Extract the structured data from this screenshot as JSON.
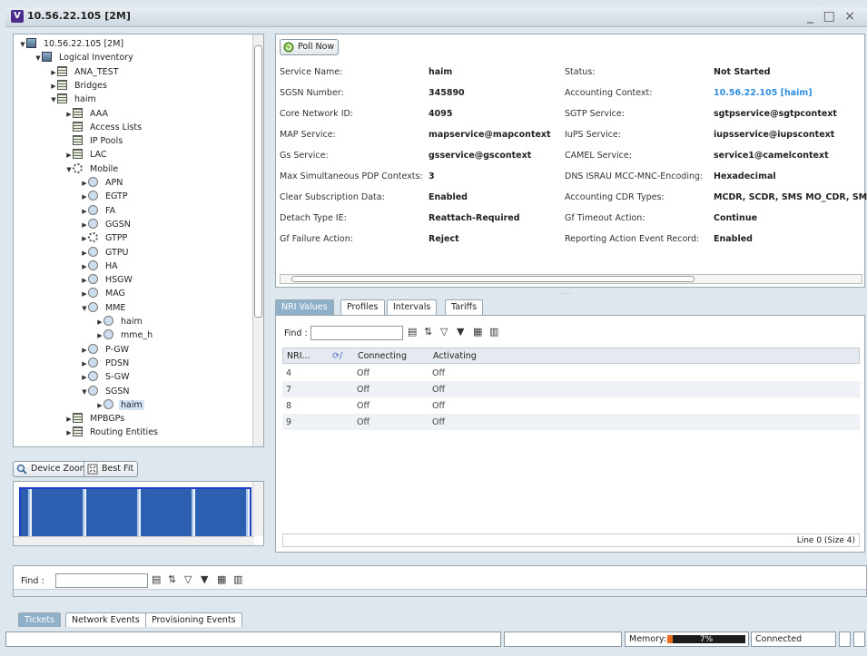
{
  "window": {
    "title": "10.56.22.105 [2M]",
    "app_letter": "V",
    "controls": "_ □ ×"
  },
  "tree": [
    {
      "label": "10.56.22.105 [2M]",
      "level": 0,
      "icon": "device-icon",
      "toggle": "expanded"
    },
    {
      "label": "Logical Inventory",
      "level": 1,
      "icon": "logical-inventory-icon",
      "toggle": "expanded"
    },
    {
      "label": "ANA_TEST",
      "level": 2,
      "icon": "context-icon",
      "toggle": "collapsed"
    },
    {
      "label": "Bridges",
      "level": 2,
      "icon": "context-icon",
      "toggle": "collapsed"
    },
    {
      "label": "haim",
      "level": 2,
      "icon": "context-icon",
      "toggle": "expanded"
    },
    {
      "label": "AAA",
      "level": 3,
      "icon": "folder-icon",
      "toggle": "collapsed"
    },
    {
      "label": "Access Lists",
      "level": 3,
      "icon": "folder-icon",
      "toggle": "none"
    },
    {
      "label": "IP Pools",
      "level": 3,
      "icon": "folder-icon",
      "toggle": "none"
    },
    {
      "label": "LAC",
      "level": 3,
      "icon": "folder-icon",
      "toggle": "collapsed"
    },
    {
      "label": "Mobile",
      "level": 3,
      "icon": "mobile-icon",
      "toggle": "expanded"
    },
    {
      "label": "APN",
      "level": 4,
      "icon": "apn-icon",
      "toggle": "collapsed"
    },
    {
      "label": "EGTP",
      "level": 4,
      "icon": "service-icon",
      "toggle": "collapsed"
    },
    {
      "label": "FA",
      "level": 4,
      "icon": "service-icon",
      "toggle": "collapsed"
    },
    {
      "label": "GGSN",
      "level": 4,
      "icon": "service-icon",
      "toggle": "collapsed"
    },
    {
      "label": "GTPP",
      "level": 4,
      "icon": "gear-icon",
      "toggle": "collapsed"
    },
    {
      "label": "GTPU",
      "level": 4,
      "icon": "service-icon",
      "toggle": "collapsed"
    },
    {
      "label": "HA",
      "level": 4,
      "icon": "service-icon",
      "toggle": "collapsed"
    },
    {
      "label": "HSGW",
      "level": 4,
      "icon": "service-icon",
      "toggle": "collapsed"
    },
    {
      "label": "MAG",
      "level": 4,
      "icon": "service-icon",
      "toggle": "collapsed"
    },
    {
      "label": "MME",
      "level": 4,
      "icon": "service-icon",
      "toggle": "expanded"
    },
    {
      "label": "haim",
      "level": 5,
      "icon": "service-instance-icon",
      "toggle": "collapsed"
    },
    {
      "label": "mme_h",
      "level": 5,
      "icon": "service-instance-icon",
      "toggle": "collapsed"
    },
    {
      "label": "P-GW",
      "level": 4,
      "icon": "service-icon",
      "toggle": "collapsed"
    },
    {
      "label": "PDSN",
      "level": 4,
      "icon": "service-icon",
      "toggle": "collapsed"
    },
    {
      "label": "S-GW",
      "level": 4,
      "icon": "service-icon",
      "toggle": "collapsed"
    },
    {
      "label": "SGSN",
      "level": 4,
      "icon": "service-icon",
      "toggle": "expanded"
    },
    {
      "label": "haim",
      "level": 5,
      "icon": "service-instance-icon",
      "toggle": "collapsed",
      "selected": true
    },
    {
      "label": "MPBGPs",
      "level": 3,
      "icon": "folder-icon",
      "toggle": "collapsed"
    },
    {
      "label": "Routing Entities",
      "level": 3,
      "icon": "folder-icon",
      "toggle": "collapsed"
    }
  ],
  "zoom": {
    "device_zoom": "Device Zoom",
    "best_fit": "Best Fit"
  },
  "details": {
    "poll_now": "Poll Now",
    "left": [
      {
        "key": "Service Name:",
        "value": "haim"
      },
      {
        "key": "SGSN Number:",
        "value": "345890"
      },
      {
        "key": "Core Network ID:",
        "value": "4095"
      },
      {
        "key": "MAP Service:",
        "value": "mapservice@mapcontext"
      },
      {
        "key": "Gs Service:",
        "value": "gsservice@gscontext"
      },
      {
        "key": "Max Simultaneous PDP Contexts:",
        "value": "3"
      },
      {
        "key": "Clear Subscription Data:",
        "value": "Enabled"
      },
      {
        "key": "Detach Type IE:",
        "value": "Reattach-Required"
      },
      {
        "key": "Gf Failure Action:",
        "value": "Reject"
      }
    ],
    "right": [
      {
        "key": "Status:",
        "value": "Not Started"
      },
      {
        "key": "Accounting Context:",
        "value": "10.56.22.105 [haim]"
      },
      {
        "key": "SGTP Service:",
        "value": "sgtpservice@sgtpcontext"
      },
      {
        "key": "IuPS Service:",
        "value": "iupsservice@iupscontext"
      },
      {
        "key": "CAMEL Service:",
        "value": "service1@camelcontext"
      },
      {
        "key": "DNS ISRAU MCC-MNC-Encoding:",
        "value": "Hexadecimal"
      },
      {
        "key": "Accounting CDR Types:",
        "value": "MCDR, SCDR, SMS MO_CDR, SMS"
      },
      {
        "key": "Gf Timeout Action:",
        "value": "Continue"
      },
      {
        "key": "Reporting Action Event Record:",
        "value": "Enabled"
      }
    ],
    "link_color": "#2f8ee0"
  },
  "tabs": [
    "NRI Values",
    "Profiles",
    "Intervals",
    "Tariffs"
  ],
  "nri": {
    "find_label": "Find :",
    "columns": [
      "NRI...",
      "Connecting",
      "Activating"
    ],
    "rows": [
      {
        "nri": "4",
        "connecting": "Off",
        "activating": "Off"
      },
      {
        "nri": "7",
        "connecting": "Off",
        "activating": "Off"
      },
      {
        "nri": "8",
        "connecting": "Off",
        "activating": "Off"
      },
      {
        "nri": "9",
        "connecting": "Off",
        "activating": "Off"
      }
    ],
    "status": "Line 0 (Size 4)"
  },
  "bottom": {
    "find_label": "Find :",
    "tabs": [
      "Tickets",
      "Network Events",
      "Provisioning Events"
    ]
  },
  "statusbar": {
    "memory_label": "Memory:",
    "memory_percent": 7,
    "memory_text": "7%",
    "connection": "Connected"
  },
  "colors": {
    "accent": "#8fb0c9",
    "memory_fill": "#e86a1a"
  }
}
